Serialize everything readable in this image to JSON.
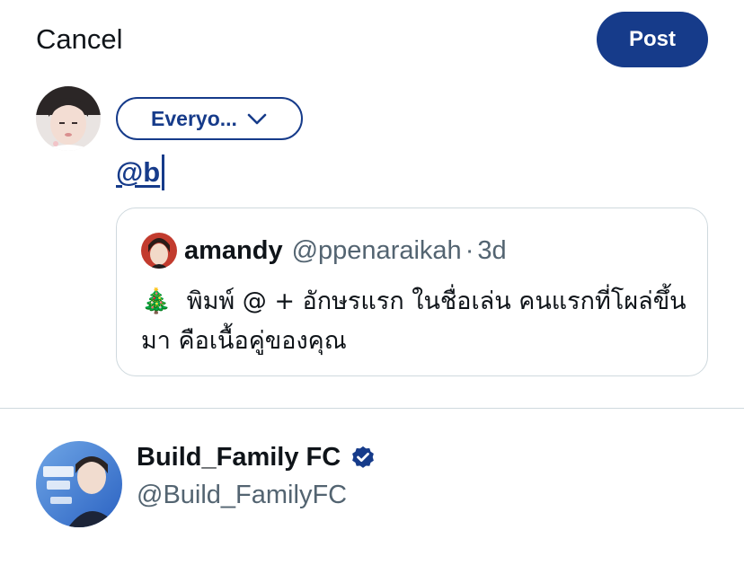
{
  "header": {
    "cancel_label": "Cancel",
    "post_label": "Post"
  },
  "composer": {
    "audience_label": "Everyo...",
    "text": "@b"
  },
  "quoted_post": {
    "author_name": "amandy",
    "author_handle": "@ppenaraikah",
    "separator": "·",
    "time": "3d",
    "emoji": "🎄",
    "text": "พิมพ์ @ + อักษรแรก ในชื่อเล่น คนแรกที่โผล่ขึ้นมา คือเนื้อคู่ของคุณ"
  },
  "mention_suggestion": {
    "name": "Build_Family FC",
    "handle": "@Build_FamilyFC",
    "verified": true
  },
  "colors": {
    "brand": "#163b8a",
    "text": "#0f1419",
    "muted": "#536471",
    "border": "#cfd9de",
    "verified_badge": "#163b8a"
  },
  "icons": {
    "audience_chevron": "chevron-down-icon",
    "verified": "verified-badge-icon"
  }
}
